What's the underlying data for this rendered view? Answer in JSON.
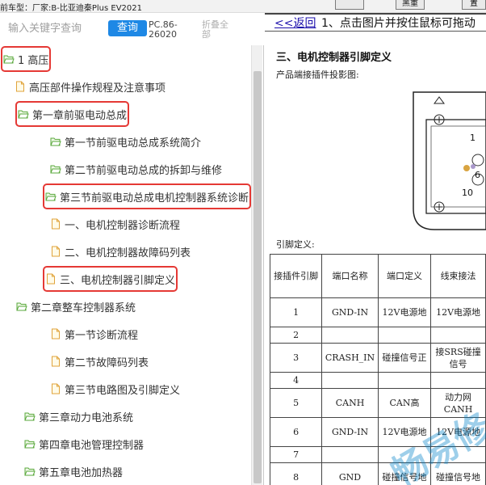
{
  "top_bar": {
    "vehicle_line": "前车型：厂家:B-比亚迪秦Plus EV2021",
    "btn_a": "",
    "btn_b": "黑重",
    "btn_c": "置"
  },
  "search": {
    "placeholder": "输入关键字查询",
    "query_label": "查询",
    "model_code": "PC.86-26020",
    "collapse_label": "折叠全部"
  },
  "tree": [
    {
      "label": "1 高压",
      "icon": "folder-open-icon",
      "highlight": true
    },
    {
      "label": "高压部件操作规程及注意事项",
      "icon": "document-icon",
      "highlight": false
    },
    {
      "label": "第一章前驱电动总成",
      "icon": "folder-open-icon",
      "highlight": true
    },
    {
      "label": "第一节前驱电动总成系统简介",
      "icon": "folder-open-icon",
      "highlight": false
    },
    {
      "label": "第二节前驱电动总成的拆卸与维修",
      "icon": "folder-open-icon",
      "highlight": false
    },
    {
      "label": "第三节前驱电动总成电机控制器系统诊断",
      "icon": "folder-open-icon",
      "highlight": true
    },
    {
      "label": "一、电机控制器诊断流程",
      "icon": "document-icon",
      "highlight": false
    },
    {
      "label": "二、电机控制器故障码列表",
      "icon": "document-icon",
      "highlight": false
    },
    {
      "label": "三、电机控制器引脚定义",
      "icon": "document-icon",
      "highlight": true
    },
    {
      "label": "第二章整车控制器系统",
      "icon": "folder-open-icon",
      "highlight": false
    },
    {
      "label": "第一节诊断流程",
      "icon": "document-icon",
      "highlight": false
    },
    {
      "label": "第二节故障码列表",
      "icon": "document-icon",
      "highlight": false
    },
    {
      "label": "第三节电路图及引脚定义",
      "icon": "document-icon",
      "highlight": false
    },
    {
      "label": "第三章动力电池系统",
      "icon": "folder-open-icon",
      "highlight": false
    },
    {
      "label": "第四章电池管理控制器",
      "icon": "folder-open-icon",
      "highlight": false
    },
    {
      "label": "第五章电池加热器",
      "icon": "folder-open-icon",
      "highlight": false
    }
  ],
  "doc": {
    "back_link": "<<返回",
    "title": "1、点击图片并按住鼠标可拖动",
    "section_title": "三、电机控制器引脚定义",
    "projection_caption": "产品端接插件投影图:",
    "connector_labels": [
      "1",
      "6",
      "10"
    ],
    "pin_def_caption": "引脚定义:",
    "table_headers": [
      "接插件引脚",
      "端口名称",
      "端口定义",
      "线束接法"
    ],
    "table_rows": [
      [
        "1",
        "GND-IN",
        "12V电源地",
        "12V电源地"
      ],
      [
        "2",
        "",
        "",
        ""
      ],
      [
        "3",
        "CRASH_IN",
        "碰撞信号正",
        "接SRS碰撞信号"
      ],
      [
        "4",
        "",
        "",
        ""
      ],
      [
        "5",
        "CANH",
        "CAN高",
        "动力网CANH"
      ],
      [
        "6",
        "GND-IN",
        "12V电源地",
        "12V电源地"
      ],
      [
        "7",
        "",
        "",
        ""
      ],
      [
        "8",
        "GND",
        "碰撞信号地",
        "碰撞信号地"
      ]
    ],
    "watermark": "畅易修"
  }
}
